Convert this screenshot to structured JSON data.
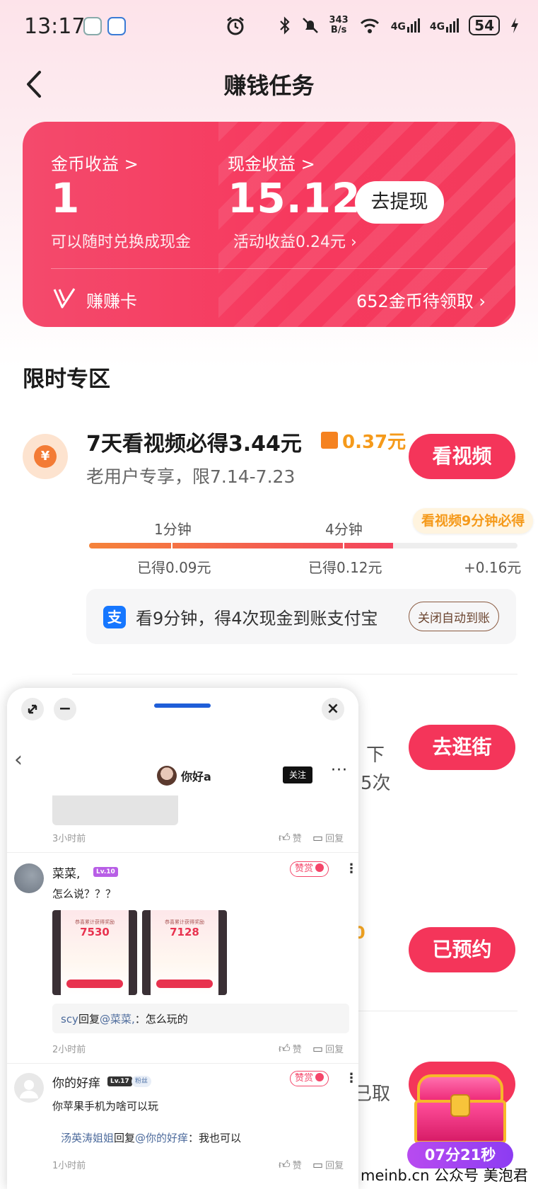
{
  "status_bar": {
    "time": "13:17",
    "speed_top": "343",
    "speed_bottom": "B/s",
    "signal1": "4G",
    "signal2": "4G",
    "battery": "54",
    "alarm_icon": "alarm-icon",
    "bluetooth_icon": "bluetooth-icon",
    "mute_icon": "bell-off-icon",
    "wifi_icon": "wifi-icon"
  },
  "header": {
    "title": "赚钱任务"
  },
  "earnings": {
    "coin_label": "金币收益 >",
    "coin_value": "1",
    "coin_hint": "可以随时兑换成现金",
    "cash_label": "现金收益 >",
    "cash_value": "15.12",
    "cash_hint": "活动收益0.24元 ›",
    "withdraw_label": "去提现",
    "card_name": "赚赚卡",
    "pending_text": "652金币待领取 ›"
  },
  "limited": {
    "section_title": "限时专区",
    "task": {
      "title": "7天看视频必得3.44元",
      "bonus": "0.37元",
      "subtitle": "老用户专享，限7.14-7.23",
      "button": "看视频",
      "coin_symbol": "¥"
    },
    "progress": {
      "tip": "看视频9分钟必得",
      "milestones": [
        {
          "time": "1分钟",
          "earn": "已得0.09元"
        },
        {
          "time": "4分钟",
          "earn": "已得0.12元"
        },
        {
          "time": "",
          "earn": "+0.16元"
        }
      ],
      "fraction": 0.71
    },
    "alipay": {
      "icon_char": "支",
      "text": "看9分钟，得4次现金到账支付宝",
      "button": "关闭自动到账"
    }
  },
  "background_tasks": {
    "btn_shop": "去逛街",
    "btn_reserved": "已预约",
    "frag1": "下",
    "frag2": "5次",
    "frag3": "0",
    "frag4": "已取"
  },
  "panel": {
    "close_char": "×",
    "minus_char": "−",
    "back_char": "‹",
    "user_name": "你好a",
    "follow": "关注",
    "more": "···",
    "first_time": "3小时前",
    "like": "赞",
    "reply": "回复",
    "comments": [
      {
        "name": "菜菜,",
        "level": "Lv.10",
        "tip": "赞赏",
        "text": "怎么说？？？",
        "thumbs": [
          {
            "title": "恭喜累计获得奖励",
            "number": "7530"
          },
          {
            "title": "恭喜累计获得奖励",
            "number": "7128"
          }
        ],
        "reply_who": "scy",
        "reply_mid": "回复",
        "reply_at": "@菜菜,",
        "reply_text": "：怎么玩的",
        "time": "2小时前"
      },
      {
        "name": "你的好痒",
        "level": "Lv.17",
        "tag": "粉丝",
        "tip": "赞赏",
        "text": "你苹果手机为啥可以玩",
        "reply_who": "汤英涛姐姐",
        "reply_mid": "回复",
        "reply_at": "@你的好痒",
        "reply_text": "：我也可以",
        "time": "1小时前"
      }
    ]
  },
  "floating": {
    "timer": "07分21秒"
  },
  "watermark": "meinb.cn  公众号 美泡君"
}
